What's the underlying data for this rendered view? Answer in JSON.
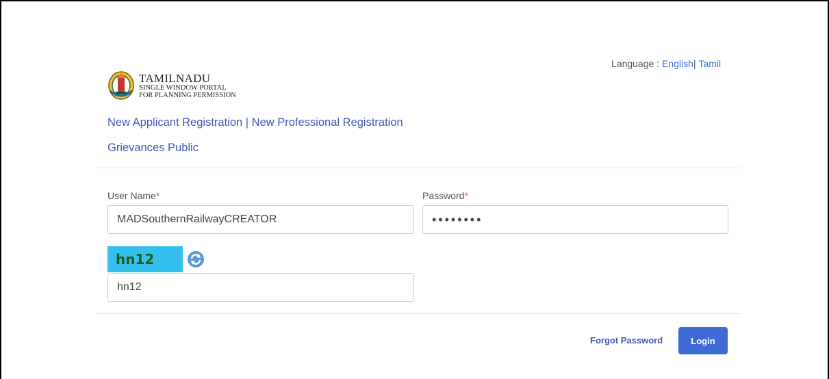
{
  "language": {
    "label": "Language : ",
    "options": [
      "English",
      "Tamil"
    ],
    "separator": "|"
  },
  "logo": {
    "title": "TAMILNADU",
    "line1": "SINGLE WINDOW PORTAL",
    "line2": "FOR PLANNING PERMISSION",
    "icon": "tamil-nadu-emblem"
  },
  "links": {
    "new_applicant": "New Applicant Registration",
    "separator": " | ",
    "new_professional": "New Professional Registration",
    "grievances": "Grievances Public"
  },
  "form": {
    "username_label": "User Name",
    "password_label": "Password",
    "required_mark": "*",
    "username_value": "MADSouthernRailwayCREATOR",
    "password_value": "••••••••",
    "captcha_text": "hn12",
    "captcha_input_value": "hn12",
    "refresh_icon": "refresh-icon"
  },
  "actions": {
    "forgot_password": "Forgot Password",
    "login": "Login"
  },
  "colors": {
    "link": "#3f58b5",
    "button": "#3d6ad6",
    "captcha_bg": "#33c0ee",
    "required": "#d9534f"
  }
}
